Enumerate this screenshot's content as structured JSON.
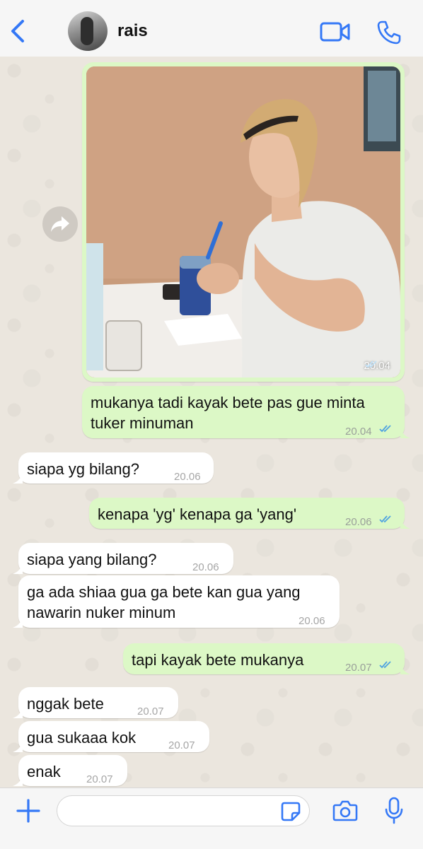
{
  "header": {
    "contact_name": "rais",
    "icons": {
      "back": "chevron-left-icon",
      "video": "video-camera-icon",
      "call": "phone-icon"
    },
    "accent_color": "#3478f6"
  },
  "photo_message": {
    "time": "20.04",
    "status": "read"
  },
  "messages": [
    {
      "direction": "out",
      "lines": [
        "mukanya tadi kayak bete pas gue minta",
        "tuker minuman"
      ],
      "time": "20.04",
      "status": "read"
    },
    {
      "direction": "in",
      "lines": [
        "siapa yg bilang?"
      ],
      "time": "20.06"
    },
    {
      "direction": "out",
      "lines": [
        "kenapa 'yg' kenapa ga 'yang'"
      ],
      "time": "20.06",
      "status": "read"
    },
    {
      "direction": "in",
      "lines": [
        "siapa yang bilang?"
      ],
      "time": "20.06"
    },
    {
      "direction": "in",
      "lines": [
        "ga ada shiaa gua ga bete kan gua yang",
        "nawarin nuker minum"
      ],
      "time": "20.06"
    },
    {
      "direction": "out",
      "lines": [
        "tapi kayak bete mukanya"
      ],
      "time": "20.07",
      "status": "read"
    },
    {
      "direction": "in",
      "lines": [
        "nggak bete"
      ],
      "time": "20.07"
    },
    {
      "direction": "in",
      "lines": [
        "gua sukaaa kok"
      ],
      "time": "20.07"
    },
    {
      "direction": "in",
      "lines": [
        "enak"
      ],
      "time": "20.07"
    }
  ],
  "input_bar": {
    "placeholder": "",
    "icons": {
      "attach": "plus-icon",
      "sticker": "sticker-icon",
      "camera": "camera-icon",
      "mic": "microphone-icon"
    }
  },
  "colors": {
    "outgoing_bubble": "#dcf8c6",
    "incoming_bubble": "#ffffff",
    "read_ticks": "#4fa3e0"
  }
}
